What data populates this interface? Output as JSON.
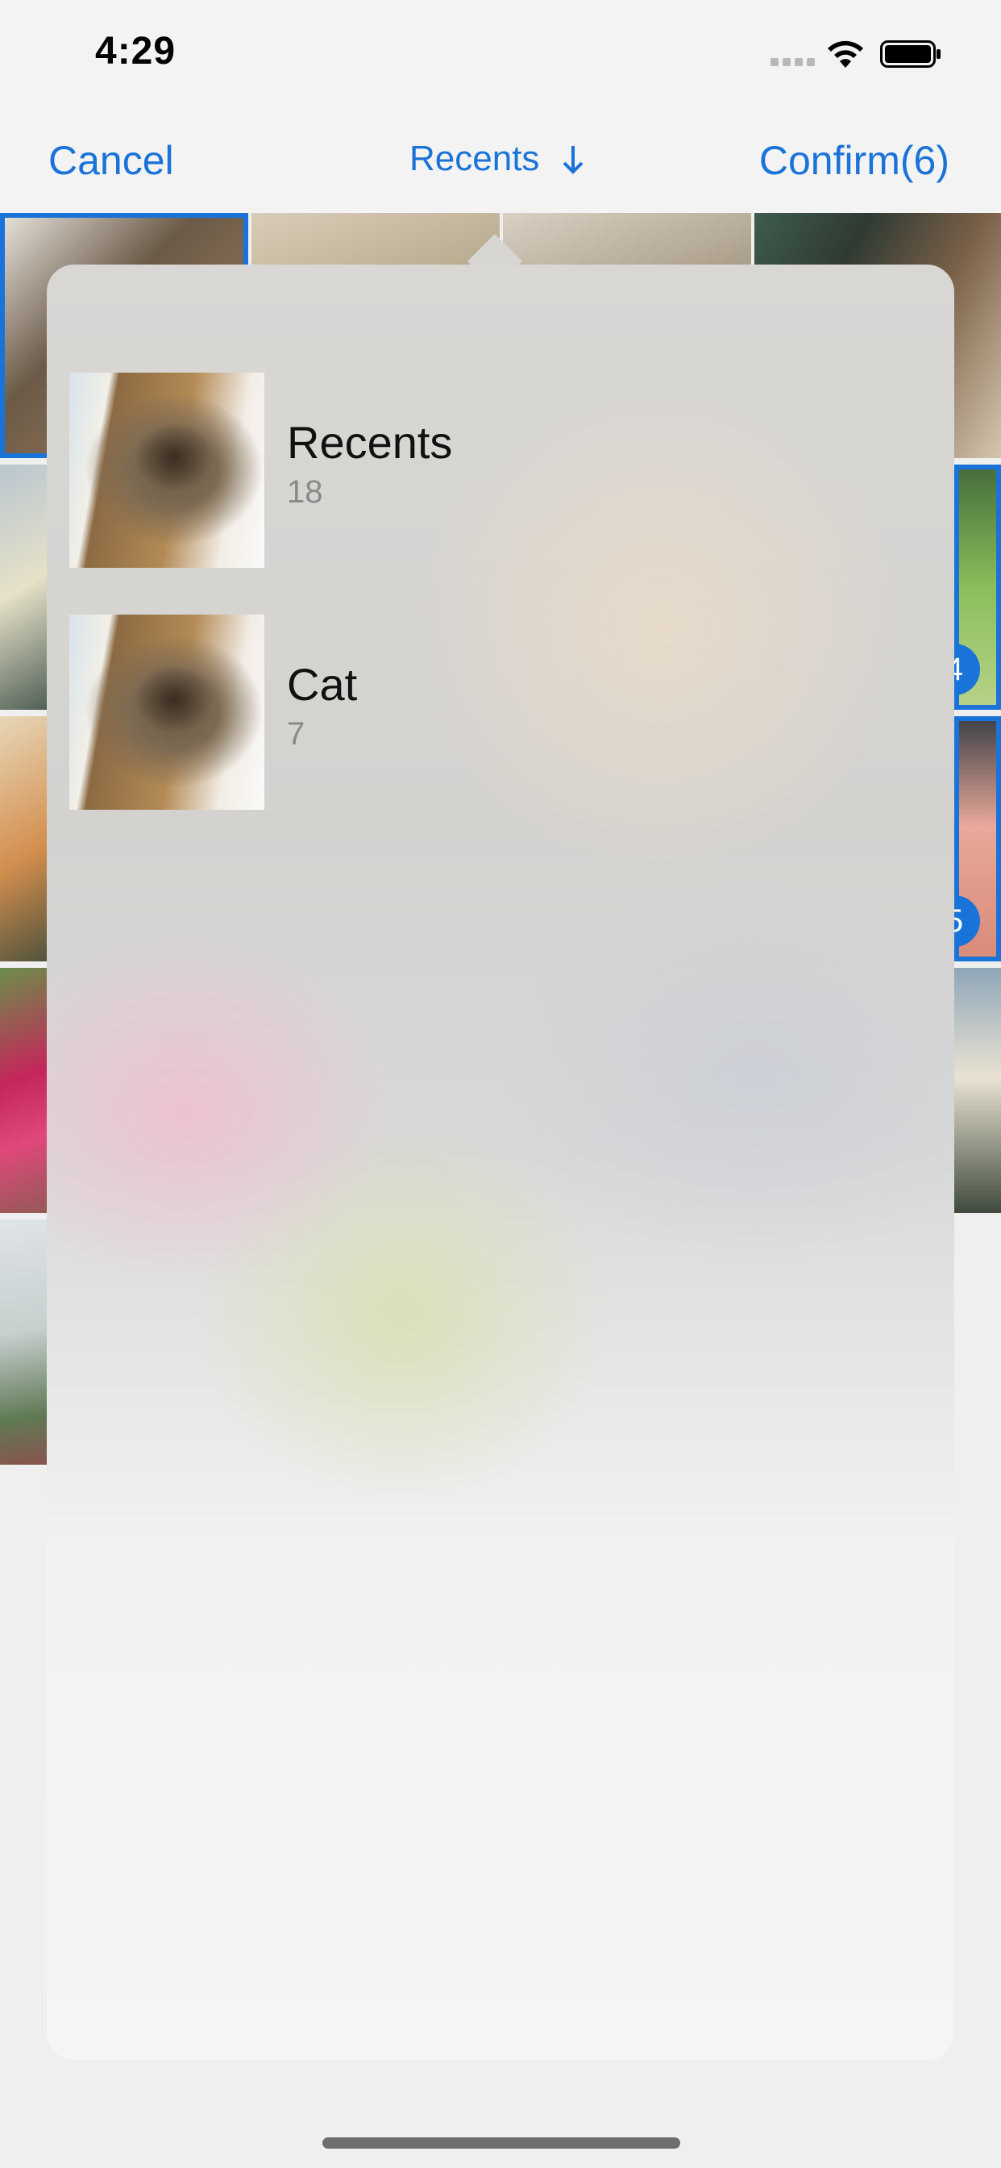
{
  "status_bar": {
    "time": "4:29",
    "icons": [
      "cellular-signal-icon",
      "wifi-icon",
      "battery-icon"
    ]
  },
  "nav": {
    "cancel_label": "Cancel",
    "title": "Recents",
    "title_icon": "arrow-down-icon",
    "confirm_label": "Confirm(6)"
  },
  "grid": {
    "visible_badges": [
      "4",
      "5"
    ]
  },
  "albums": [
    {
      "name": "Recents",
      "count": "18"
    },
    {
      "name": "Cat",
      "count": "7"
    }
  ],
  "colors": {
    "accent": "#1a73d9",
    "background": "#efefef"
  }
}
